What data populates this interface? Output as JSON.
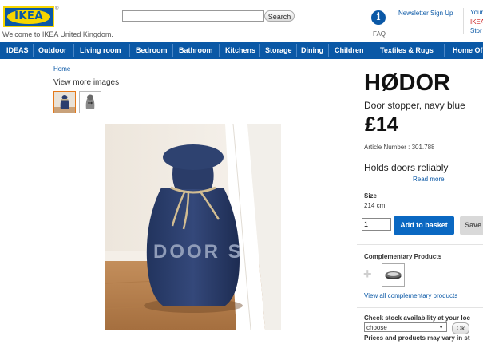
{
  "header": {
    "logo_text": "IKEA",
    "welcome": "Welcome to IKEA United Kingdom.",
    "search": {
      "value": "",
      "button_label": "Search"
    },
    "faq_label": "FAQ",
    "newsletter": "Newsletter Sign Up",
    "right_links": [
      "Your",
      "IKEA",
      "Stor"
    ]
  },
  "nav": {
    "items": [
      "IDEAS",
      "Outdoor",
      "Living room",
      "Bedroom",
      "Bathroom",
      "Kitchens",
      "Storage",
      "Dining",
      "Children",
      "Textiles & Rugs",
      "Home Of"
    ]
  },
  "breadcrumb": "Home",
  "gallery": {
    "more_images_label": "View more images",
    "photo_text": "DOOR S"
  },
  "product": {
    "name": "HØDOR",
    "description": "Door stopper, navy blue",
    "price": "£14",
    "article_number": "Article Number : 301.788",
    "tagline": "Holds doors reliably",
    "read_more": "Read more",
    "size_label": "Size",
    "size_value": "214 cm",
    "quantity": "1",
    "add_to_basket": "Add to basket",
    "save": "Save"
  },
  "complementary": {
    "title": "Complementary Products",
    "view_all": "View all complementary products"
  },
  "stock": {
    "title": "Check stock availability at your loc",
    "select_value": "choose",
    "ok_label": "Ok",
    "note": "Prices and products may vary in st"
  },
  "colors": {
    "brand_blue": "#0a58a6",
    "brand_yellow": "#f7d600",
    "button_blue": "#0a68c2",
    "thumb_active": "#e5791a"
  }
}
